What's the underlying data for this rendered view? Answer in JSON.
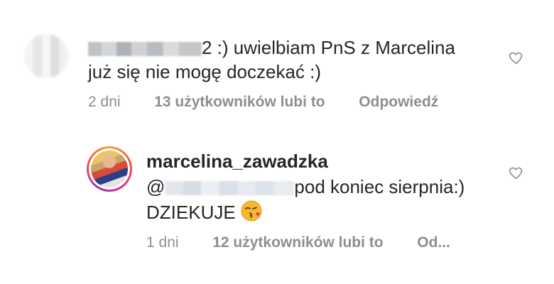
{
  "comments": [
    {
      "username": "",
      "text_line1": "2 :) uwielbiam PnS z Marcelina",
      "text_line2": "już się nie mogę doczekać :)",
      "time": "2 dni",
      "likes": "13 użytkowników lubi to",
      "reply": "Odpowiedź"
    },
    {
      "username": "marcelina_zawadzka",
      "mention_prefix": "@",
      "text_line1": "pod koniec sierpnia:)",
      "text_line2": "DZIEKUJE",
      "emoji": "kissing-face-emoji",
      "time": "1 dni",
      "likes": "12 użytkowników lubi to",
      "reply": "Od..."
    }
  ],
  "icons": {
    "like": "heart-outline-icon"
  },
  "colors": {
    "text": "#262626",
    "meta": "#8e8e8e"
  }
}
